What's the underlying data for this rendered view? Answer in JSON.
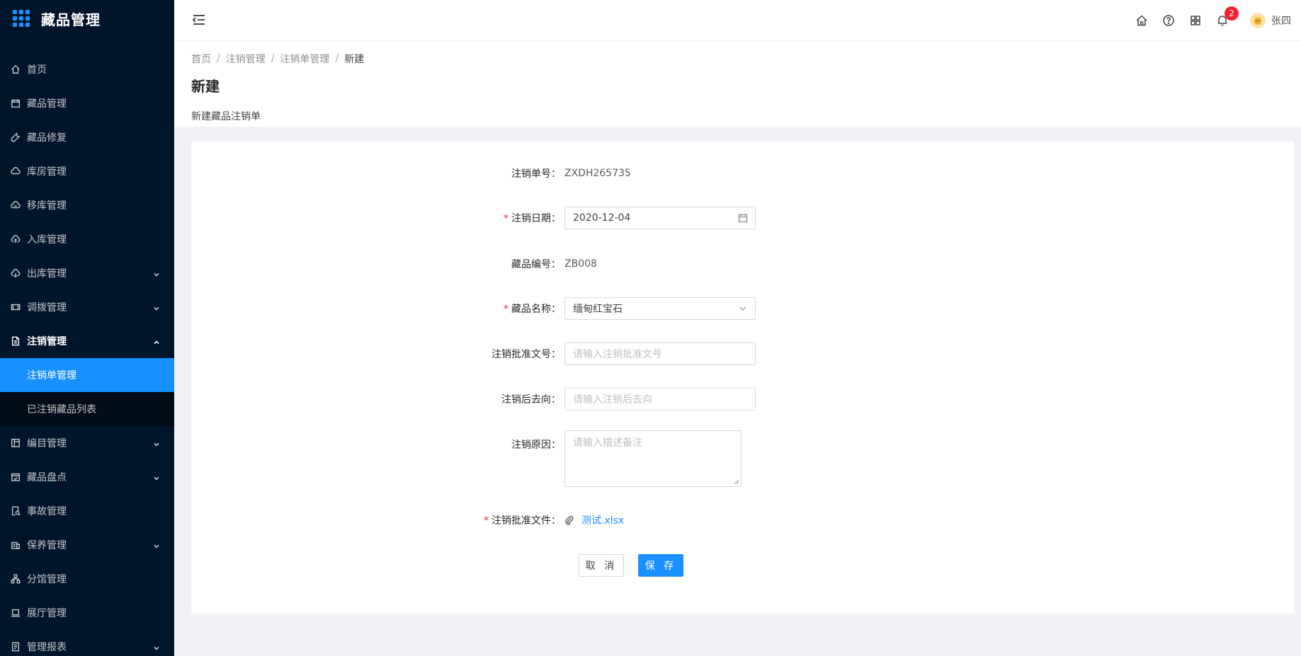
{
  "app": {
    "title": "藏品管理"
  },
  "sidebar": {
    "items": [
      {
        "label": "首页",
        "icon": "home-icon"
      },
      {
        "label": "藏品管理",
        "icon": "calendar-icon"
      },
      {
        "label": "藏品修复",
        "icon": "tool-icon"
      },
      {
        "label": "库房管理",
        "icon": "cloud-icon"
      },
      {
        "label": "移库管理",
        "icon": "cloud-sync-icon"
      },
      {
        "label": "入库管理",
        "icon": "cloud-upload-icon"
      },
      {
        "label": "出库管理",
        "icon": "cloud-download-icon"
      },
      {
        "label": "调拨管理",
        "icon": "swap-icon"
      },
      {
        "label": "注销管理",
        "icon": "file-icon"
      },
      {
        "label": "编目管理",
        "icon": "book-icon"
      },
      {
        "label": "藏品盘点",
        "icon": "check-calendar-icon"
      },
      {
        "label": "事故管理",
        "icon": "file-search-icon"
      },
      {
        "label": "保养管理",
        "icon": "building-icon"
      },
      {
        "label": "分馆管理",
        "icon": "cluster-icon"
      },
      {
        "label": "展厅管理",
        "icon": "laptop-icon"
      },
      {
        "label": "管理报表",
        "icon": "report-icon"
      }
    ],
    "submenu": [
      {
        "label": "注销单管理"
      },
      {
        "label": "已注销藏品列表"
      }
    ]
  },
  "header": {
    "notification_count": "2",
    "username": "张四"
  },
  "breadcrumb": [
    "首页",
    "注销管理",
    "注销单管理",
    "新建"
  ],
  "page": {
    "title": "新建",
    "description": "新建藏品注销单"
  },
  "form": {
    "cancel_no": {
      "label": "注销单号",
      "value": "ZXDH265735"
    },
    "cancel_date": {
      "label": "注销日期",
      "value": "2020-12-04"
    },
    "item_no": {
      "label": "藏品编号",
      "value": "ZB008"
    },
    "item_name": {
      "label": "藏品名称",
      "value": "缅甸红宝石"
    },
    "approval_no": {
      "label": "注销批准文号",
      "placeholder": "请输入注销批准文号"
    },
    "destination": {
      "label": "注销后去向",
      "placeholder": "请输入注销后去向"
    },
    "reason": {
      "label": "注销原因",
      "placeholder": "请输入描述备注"
    },
    "approval_file": {
      "label": "注销批准文件",
      "file": "测试.xlsx"
    },
    "cancel_button": "取 消",
    "save_button": "保 存"
  },
  "colors": {
    "primary": "#1890ff",
    "sidebar_bg": "#001529",
    "required": "#f5222d"
  }
}
